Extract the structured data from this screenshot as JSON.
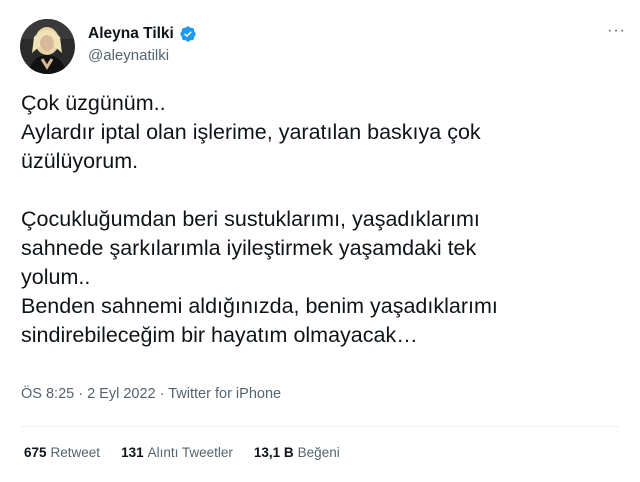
{
  "user": {
    "display_name": "Aleyna Tilki",
    "handle": "@aleynatilki",
    "verified": true,
    "verified_color": "#1d9bf0"
  },
  "more_menu": {
    "label": "···"
  },
  "tweet": {
    "lines": [
      "Çok üzgünüm..",
      "Aylardır iptal olan işlerime, yaratılan baskıya çok",
      "üzülüyorum.",
      "",
      "Çocukluğumdan beri sustuklarımı, yaşadıklarımı",
      "sahnede şarkılarımla iyileştirmek yaşamdaki tek",
      "yolum..",
      "Benden sahnemi aldığınızda, benim yaşadıklarımı",
      "sindirebileceğim bir hayatım olmayacak…"
    ]
  },
  "meta": {
    "time": "ÖS 8:25",
    "separator": " · ",
    "date": "2 Eyl 2022",
    "source": "Twitter for iPhone"
  },
  "stats": {
    "retweets_count": "675",
    "retweets_label": "Retweet",
    "quotes_count": "131",
    "quotes_label": "Alıntı Tweetler",
    "likes_count": "13,1 B",
    "likes_label": "Beğeni"
  },
  "colors": {
    "text_primary": "#0f1419",
    "text_secondary": "#536471",
    "divider": "#eff3f4"
  }
}
